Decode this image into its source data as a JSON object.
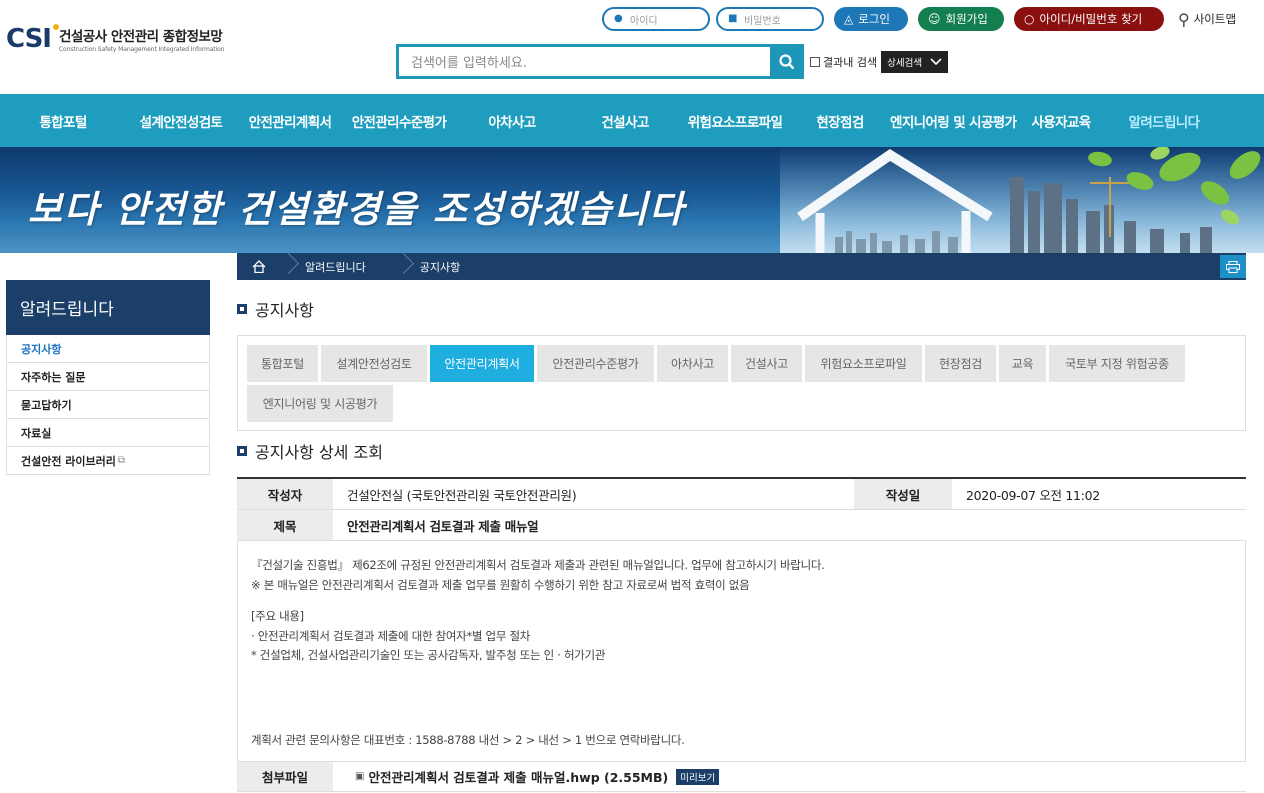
{
  "logo": {
    "mark": "CSI",
    "title_ko": "건설공사 안전관리 종합정보망",
    "title_en": "Construction Safety Management Integrated Information"
  },
  "util": {
    "id_placeholder": "아이디",
    "pw_placeholder": "비밀번호",
    "login_label": "로그인",
    "join_label": "회원가입",
    "find_label": "아이디/비밀번호 찾기",
    "sitemap_label": "사이트맵"
  },
  "search": {
    "placeholder": "검색어를 입력하세요.",
    "within_label": "결과내 검색",
    "advanced_label": "상세검색"
  },
  "gnb": [
    {
      "label": "통합포털",
      "w": 126
    },
    {
      "label": "설계안전성검토",
      "w": 110
    },
    {
      "label": "안전관리계획서",
      "w": 108
    },
    {
      "label": "안전관리수준평가",
      "w": 110
    },
    {
      "label": "아차사고",
      "w": 116
    },
    {
      "label": "건설사고",
      "w": 110
    },
    {
      "label": "위험요소프로파일",
      "w": 110
    },
    {
      "label": "현장점검",
      "w": 100
    },
    {
      "label": "엔지니어링 및 시공평가",
      "w": 126
    },
    {
      "label": "사용자교육",
      "w": 90
    },
    {
      "label": "알려드립니다",
      "w": 116
    }
  ],
  "banner": {
    "slogan": "보다 안전한 건설환경을 조성하겠습니다"
  },
  "location": {
    "level1": "알려드립니다",
    "level2": "공지사항"
  },
  "side": {
    "title": "알려드립니다",
    "items": [
      {
        "label": "공지사항",
        "active": true
      },
      {
        "label": "자주하는 질문",
        "active": false
      },
      {
        "label": "묻고답하기",
        "active": false
      },
      {
        "label": "자료실",
        "active": false
      },
      {
        "label": "건설안전 라이브러리",
        "active": false
      }
    ]
  },
  "page": {
    "section_title": "공지사항",
    "detail_title": "공지사항 상세 조회"
  },
  "tabs": [
    {
      "label": "통합포털",
      "w": 71
    },
    {
      "label": "설계안전성검토",
      "w": 106
    },
    {
      "label": "안전관리계획서",
      "w": 104,
      "active": true
    },
    {
      "label": "안전관리수준평가",
      "w": 117
    },
    {
      "label": "아차사고",
      "w": 71
    },
    {
      "label": "건설사고",
      "w": 71
    },
    {
      "label": "위험요소프로파일",
      "w": 117
    },
    {
      "label": "현장점검",
      "w": 71
    },
    {
      "label": "교육",
      "w": 47
    },
    {
      "label": "국토부 지정 위험공종",
      "w": 136
    },
    {
      "label": "엔지니어링 및 시공평가",
      "w": 146
    }
  ],
  "detail": {
    "author_label": "작성자",
    "author": "건설안전실 (국토안전관리원 국토안전관리원)",
    "date_label": "작성일",
    "date": "2020-09-07 오전 11:02",
    "subject_label": "제목",
    "subject": "안전관리계획서 검토결과 제출 매뉴얼",
    "body_lines": [
      "『건설기술 진흥법』 제62조에 규정된 안전관리계획서 검토결과 제출과 관련된 매뉴얼입니다. 업무에 참고하시기 바랍니다.",
      "※ 본 매뉴얼은 안전관리계획서 검토결과 제출 업무를 원활히 수행하기 위한 참고 자료로써 법적 효력이 없음",
      "[주요 내용]",
      "  · 안전관리계획서 검토결과 제출에 대한 참여자*별 업무 절차",
      "* 건설업체, 건설사업관리기술인 또는 공사감독자, 발주청 또는 인 · 허가기관"
    ],
    "footer_note": "계획서 관련 문의사항은 대표번호 : 1588-8788 내선 > 2 > 내선 > 1 번으로 연락바랍니다.",
    "attach_label": "첨부파일",
    "attach_file": "안전관리계획서 검토결과 제출 매뉴얼.hwp (2.55MB)",
    "preview_label": "미리보기"
  }
}
